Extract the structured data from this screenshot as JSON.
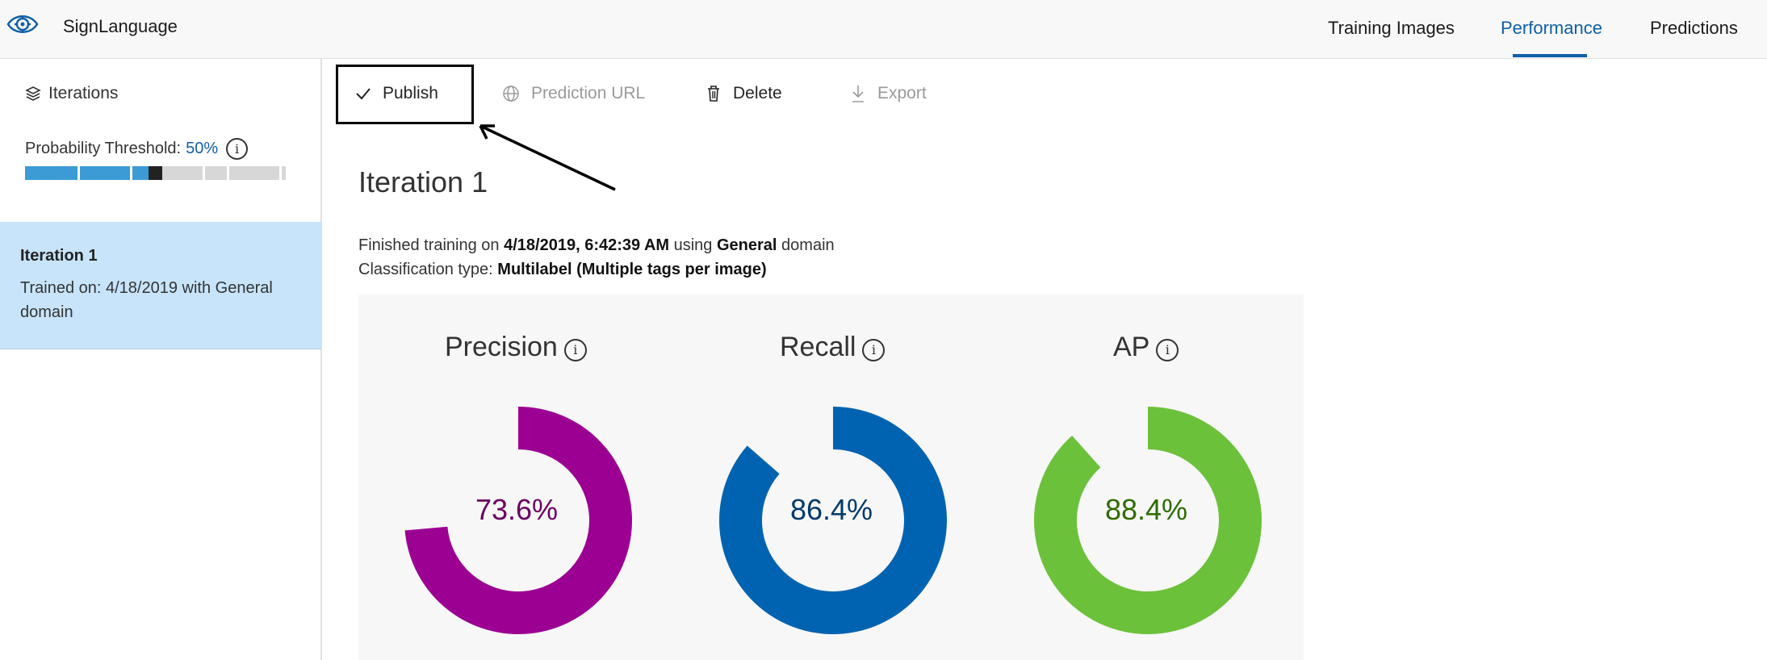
{
  "header": {
    "app_name": "SignLanguage",
    "nav": [
      "Training Images",
      "Performance",
      "Predictions"
    ],
    "active_tab": "Performance",
    "accent_color": "#0f5fa6"
  },
  "sidebar": {
    "iterations_label": "Iterations",
    "threshold_label": "Probability Threshold:",
    "threshold_value": "50%",
    "threshold_fraction": 0.5,
    "iteration_item": {
      "title": "Iteration 1",
      "description": "Trained on: 4/18/2019 with General domain"
    }
  },
  "toolbar": {
    "publish": "Publish",
    "prediction_url": "Prediction URL",
    "delete": "Delete",
    "export": "Export"
  },
  "main": {
    "title": "Iteration 1",
    "line1": {
      "prefix": "Finished training on ",
      "date": "4/18/2019, 6:42:39 AM",
      "mid": " using ",
      "domain": "General",
      "suffix": " domain"
    },
    "line2": {
      "prefix": "Classification type: ",
      "type": "Multilabel (Multiple tags per image)"
    }
  },
  "metrics": [
    {
      "label": "Precision",
      "value": "73.6%",
      "fraction": 0.736,
      "ring_color": "#9b0093",
      "text_color": "#6b0063"
    },
    {
      "label": "Recall",
      "value": "86.4%",
      "fraction": 0.864,
      "ring_color": "#0063b1",
      "text_color": "#003a6b"
    },
    {
      "label": "AP",
      "value": "88.4%",
      "fraction": 0.884,
      "ring_color": "#6cc13b",
      "text_color": "#2e6b00"
    }
  ]
}
